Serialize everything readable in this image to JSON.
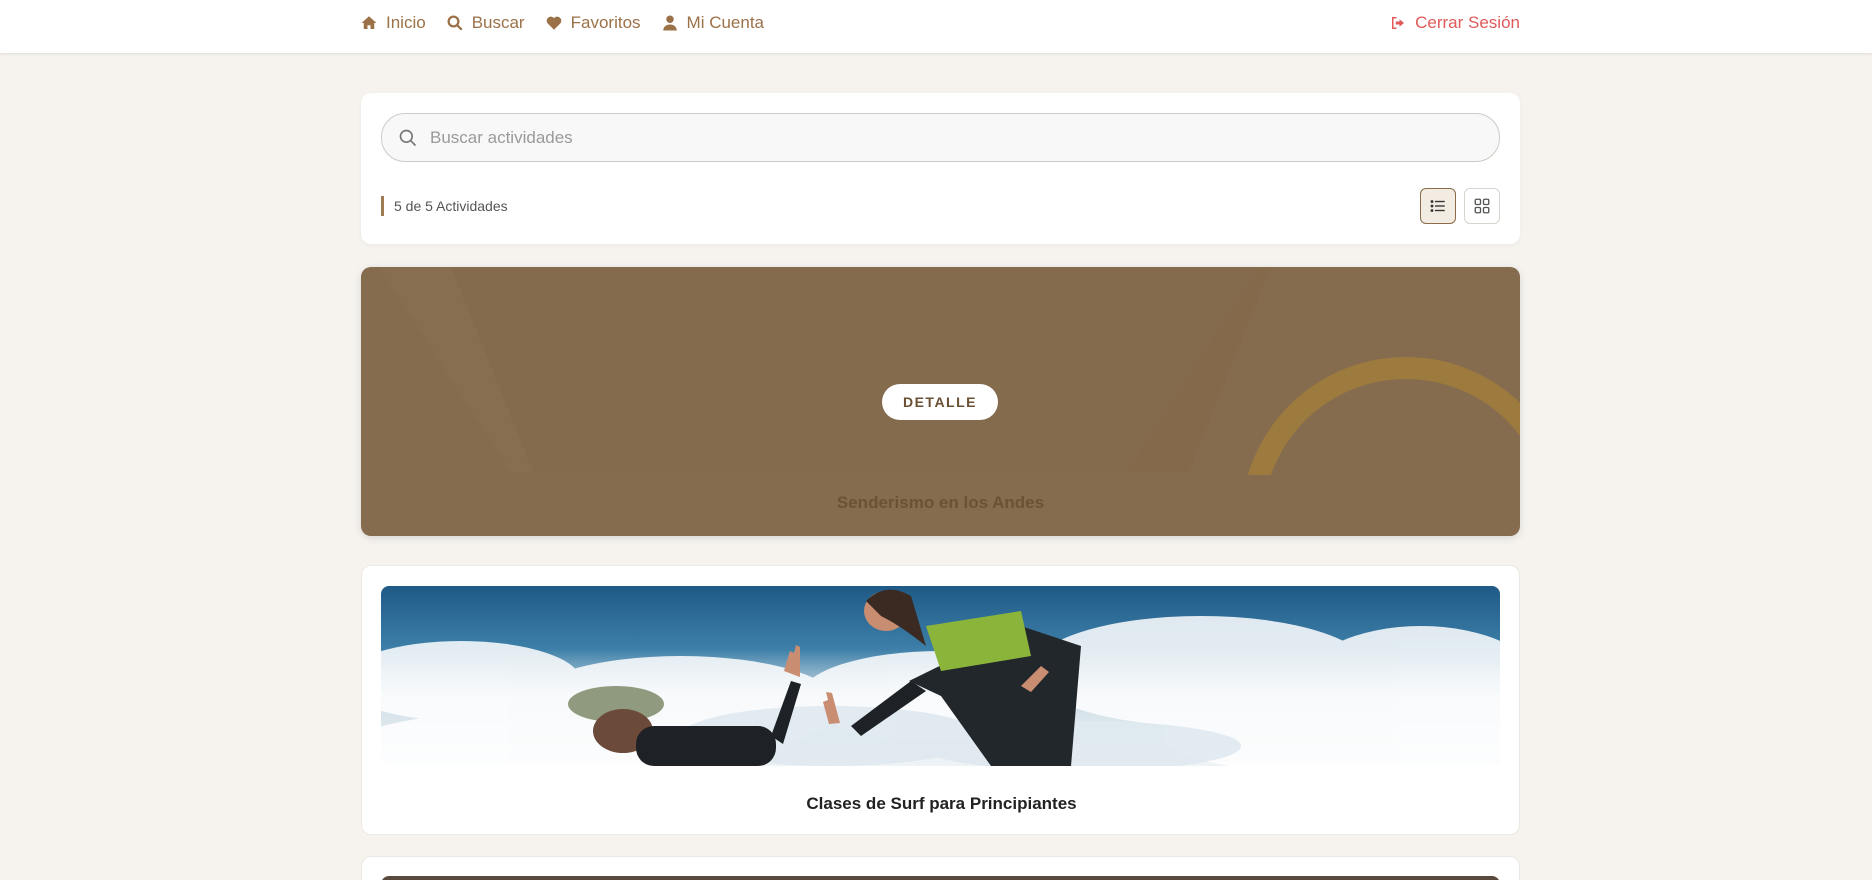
{
  "nav": {
    "items": [
      {
        "label": "Inicio",
        "icon": "home-icon"
      },
      {
        "label": "Buscar",
        "icon": "search-icon"
      },
      {
        "label": "Favoritos",
        "icon": "heart-icon"
      },
      {
        "label": "Mi Cuenta",
        "icon": "user-icon"
      }
    ],
    "logout": {
      "label": "Cerrar Sesión",
      "icon": "sign-out-icon"
    }
  },
  "search": {
    "placeholder": "Buscar actividades",
    "value": ""
  },
  "results": {
    "count_text": "5 de 5 Actividades",
    "view_mode": "list"
  },
  "activities": [
    {
      "title": "Senderismo en los Andes",
      "button_label": "DETALLE",
      "featured": true
    },
    {
      "title": "Clases de Surf para Principiantes",
      "featured": false
    }
  ],
  "colors": {
    "accent": "#9b7148",
    "logout": "#e05a5a",
    "featured_bg": "#866c4e",
    "page_bg": "#f6f3ef"
  }
}
